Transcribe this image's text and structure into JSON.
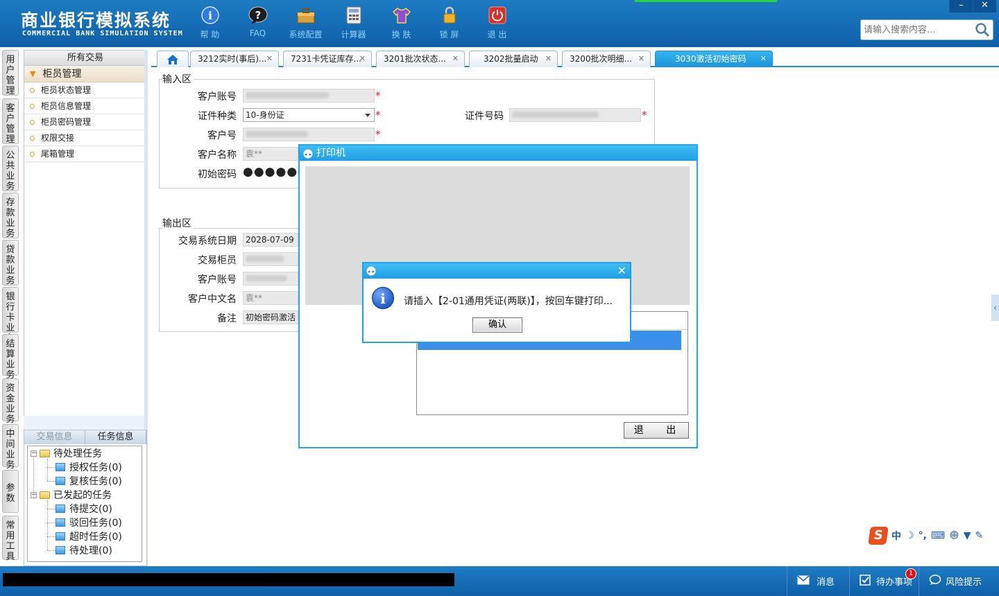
{
  "header": {
    "title": "商业银行模拟系统",
    "subtitle": "COMMERCIAL BANK SIMULATION SYSTEM",
    "toolbar": [
      {
        "label": "帮 助",
        "icon": "help-icon"
      },
      {
        "label": "FAQ",
        "icon": "faq-icon"
      },
      {
        "label": "系统配置",
        "icon": "toolbox-icon"
      },
      {
        "label": "计算器",
        "icon": "calculator-icon"
      },
      {
        "label": "换 肤",
        "icon": "shirt-icon"
      },
      {
        "label": "锁 屏",
        "icon": "lock-icon"
      },
      {
        "label": "退 出",
        "icon": "power-icon"
      }
    ],
    "search_placeholder": "请输入搜索内容...",
    "window_buttons": [
      "–",
      "✕"
    ]
  },
  "categories": [
    "用户管理",
    "客户管理",
    "公共业务",
    "存款业务",
    "贷款业务",
    "银行卡业务",
    "结算业务",
    "资金业务",
    "中间业务",
    "参数",
    "常用工具"
  ],
  "left_panel": {
    "header": "所有交易",
    "group": "柜员管理",
    "items": [
      "柜员状态管理",
      "柜员信息管理",
      "柜员密码管理",
      "权限交接",
      "尾箱管理"
    ]
  },
  "task_panel": {
    "tabs": [
      "交易信息",
      "任务信息"
    ],
    "tree": [
      {
        "label": "待处理任务",
        "children": [
          "授权任务(0)",
          "复核任务(0)"
        ]
      },
      {
        "label": "已发起的任务",
        "children": [
          "待提交(0)",
          "驳回任务(0)",
          "超时任务(0)",
          "待处理(0)"
        ]
      }
    ]
  },
  "tabs": [
    {
      "label": "3212实时(事后)...",
      "active": false
    },
    {
      "label": "7231卡凭证库存...",
      "active": false
    },
    {
      "label": "3201批次状态...",
      "active": false
    },
    {
      "label": "3202批量启动",
      "active": false
    },
    {
      "label": "3200批次明细...",
      "active": false
    },
    {
      "label": "3030激活初始密码",
      "active": true
    }
  ],
  "form": {
    "input_section": "输入区",
    "output_section": "输出区",
    "inputs": {
      "account_label": "客户账号",
      "idtype_label": "证件种类",
      "idtype_value": "10-身份证",
      "idnum_label": "证件号码",
      "custno_label": "客户号",
      "custname_label": "客户名称",
      "custname_value": "袁**",
      "initpwd_label": "初始密码",
      "initpwd_value": "●●●●●●"
    },
    "outputs": {
      "date_label": "交易系统日期",
      "date_value": "2028-07-09",
      "teller_label": "交易柜员",
      "account_label": "客户账号",
      "cname_label": "客户中文名",
      "cname_value": "袁**",
      "remark_label": "备注",
      "remark_value": "初始密码激活"
    },
    "required_mark": "*"
  },
  "printer_dialog": {
    "title": "打印机",
    "exit_button": "退 出"
  },
  "message_box": {
    "text": "请插入【2-01通用凭证(两联)】，按回车键打印...",
    "ok_button": "确认",
    "close": "✕"
  },
  "statusbar": {
    "messages": "消息",
    "todo": "待办事项",
    "todo_count": "1",
    "risk": "风险提示"
  },
  "ime": {
    "logo": "S",
    "mode": "中"
  },
  "colors": {
    "header_blue": "#1572bb",
    "accent_blue": "#1e9fe6",
    "required_red": "#d8232a",
    "badge_red": "#d8141b"
  }
}
